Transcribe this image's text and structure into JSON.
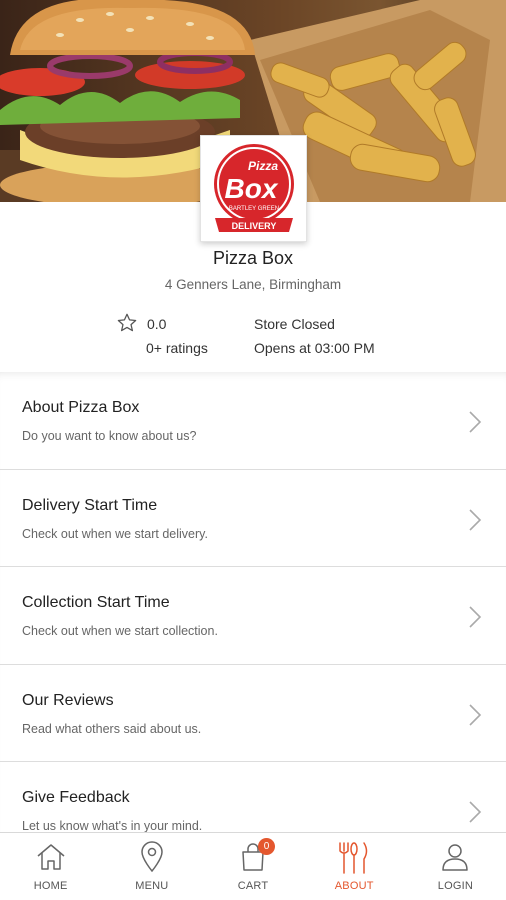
{
  "store": {
    "name": "Pizza Box",
    "address": "4 Genners Lane, Birmingham",
    "logo": {
      "text_top": "Pizza",
      "text_main": "Box",
      "text_sub": "BARTLEY GREEN",
      "text_ribbon": "DELIVERY"
    }
  },
  "rating": {
    "value": "0.0",
    "count": "0+ ratings"
  },
  "status": {
    "state": "Store Closed",
    "opens": "Opens at 03:00 PM"
  },
  "items": [
    {
      "title": "About Pizza Box",
      "subtitle": "Do you want to know about us?"
    },
    {
      "title": "Delivery Start Time",
      "subtitle": "Check out when we start delivery."
    },
    {
      "title": "Collection Start Time",
      "subtitle": "Check out when we start collection."
    },
    {
      "title": "Our Reviews",
      "subtitle": "Read what others said about us."
    },
    {
      "title": "Give Feedback",
      "subtitle": "Let us know what's in your mind."
    }
  ],
  "tabs": [
    {
      "label": "HOME",
      "icon": "home-icon"
    },
    {
      "label": "MENU",
      "icon": "location-pin-icon"
    },
    {
      "label": "CART",
      "icon": "shopping-bag-icon",
      "badge": "0"
    },
    {
      "label": "ABOUT",
      "icon": "restaurant-icon",
      "active": true
    },
    {
      "label": "LOGIN",
      "icon": "user-icon"
    }
  ],
  "colors": {
    "accent": "#e4572e",
    "logo_red": "#d7262b"
  }
}
